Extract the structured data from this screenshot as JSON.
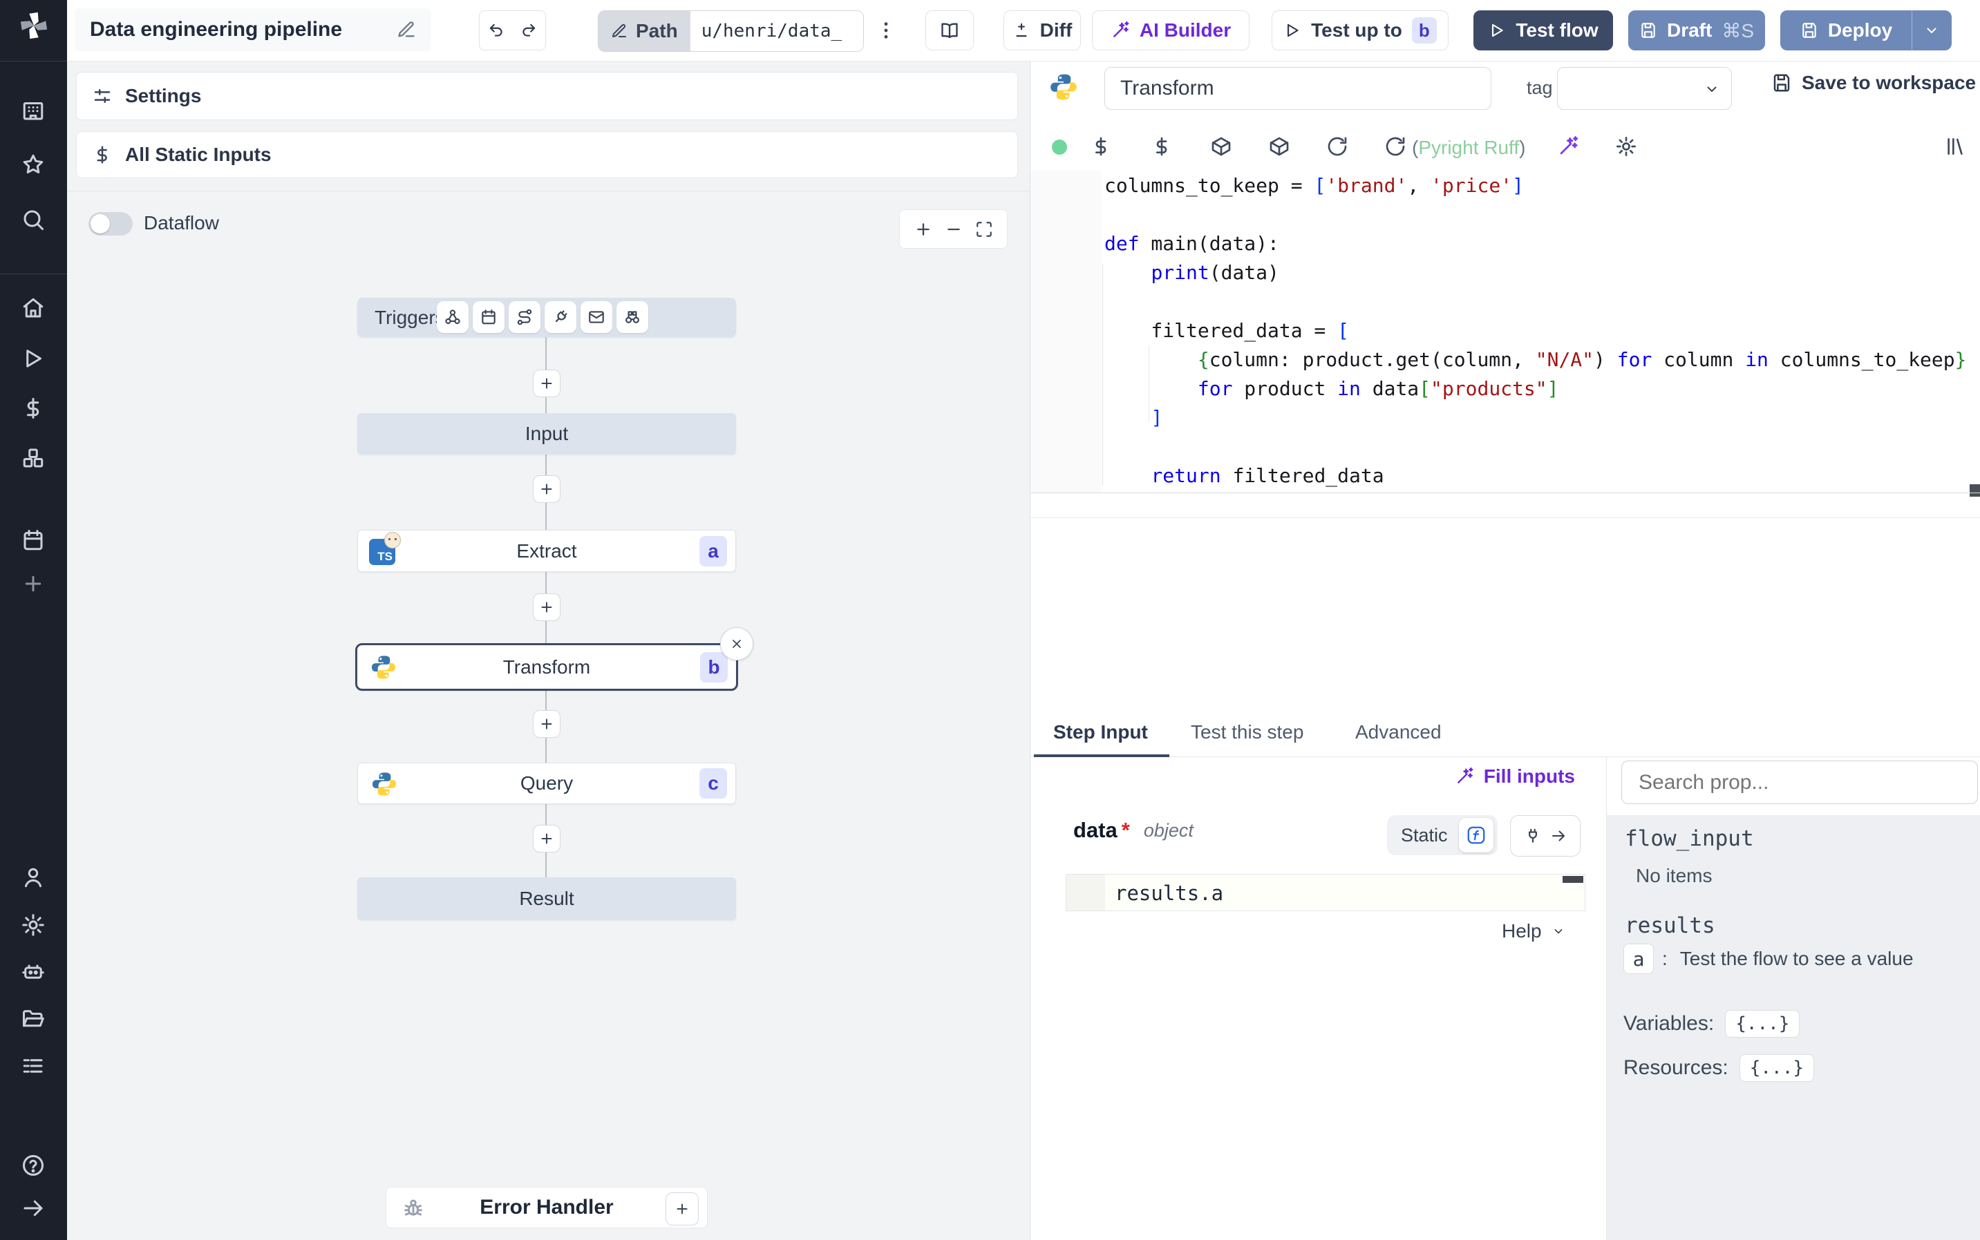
{
  "topbar": {
    "title": "Data engineering pipeline",
    "path_label": "Path",
    "path_value": "u/henri/data_",
    "diff_label": "Diff",
    "ai_builder_label": "AI Builder",
    "test_up_to_label": "Test up to",
    "test_up_to_badge": "b",
    "test_flow_label": "Test flow",
    "draft_label": "Draft",
    "draft_shortcut": "⌘S",
    "deploy_label": "Deploy"
  },
  "canvas": {
    "settings_label": "Settings",
    "static_inputs_label": "All Static Inputs",
    "dataflow_label": "Dataflow",
    "triggers_label": "Triggers",
    "nodes": {
      "input_label": "Input",
      "extract_label": "Extract",
      "extract_badge": "a",
      "extract_lang": "TS",
      "transform_label": "Transform",
      "transform_badge": "b",
      "query_label": "Query",
      "query_badge": "c",
      "result_label": "Result",
      "error_handler_label": "Error Handler"
    }
  },
  "editor": {
    "step_name": "Transform",
    "tag_label": "tag",
    "save_label": "Save to workspace",
    "lint_open": "(",
    "lint_name": "Pyright Ruff",
    "lint_close": ")",
    "code_lines": [
      [
        [
          "p",
          "columns_to_keep = "
        ],
        [
          "b",
          "["
        ],
        [
          "s",
          "'brand'"
        ],
        [
          "p",
          ", "
        ],
        [
          "s",
          "'price'"
        ],
        [
          "b",
          "]"
        ]
      ],
      [],
      [
        [
          "k",
          "def"
        ],
        [
          "p",
          " main(data):"
        ]
      ],
      [
        [
          "p",
          "    "
        ],
        [
          "k",
          "print"
        ],
        [
          "p",
          "(data)"
        ]
      ],
      [],
      [
        [
          "p",
          "    filtered_data = "
        ],
        [
          "b",
          "["
        ]
      ],
      [
        [
          "p",
          "        "
        ],
        [
          "g",
          "{"
        ],
        [
          "p",
          "column: product.get(column, "
        ],
        [
          "s",
          "\"N/A\""
        ],
        [
          "p",
          ") "
        ],
        [
          "k",
          "for"
        ],
        [
          "p",
          " column "
        ],
        [
          "k",
          "in"
        ],
        [
          "p",
          " columns_to_keep"
        ],
        [
          "g",
          "}"
        ]
      ],
      [
        [
          "p",
          "        "
        ],
        [
          "k",
          "for"
        ],
        [
          "p",
          " product "
        ],
        [
          "k",
          "in"
        ],
        [
          "p",
          " data"
        ],
        [
          "g",
          "["
        ],
        [
          "s",
          "\"products\""
        ],
        [
          "g",
          "]"
        ]
      ],
      [
        [
          "p",
          "    "
        ],
        [
          "b",
          "]"
        ]
      ],
      [],
      [
        [
          "p",
          "    "
        ],
        [
          "k",
          "return"
        ],
        [
          "p",
          " filtered_data"
        ]
      ]
    ]
  },
  "tabs": {
    "step_input": "Step Input",
    "test_this_step": "Test this step",
    "advanced": "Advanced"
  },
  "step_panel": {
    "fill_inputs_label": "Fill inputs",
    "field_name": "data",
    "required_mark": "*",
    "field_type": "object",
    "static_label": "Static",
    "expr_value": "results.a",
    "help_label": "Help"
  },
  "prop_panel": {
    "search_placeholder": "Search prop...",
    "flow_input_label": "flow_input",
    "flow_input_empty": "No items",
    "results_label": "results",
    "result_key": "a",
    "result_separator": ":",
    "result_hint": "Test the flow to see a value",
    "variables_label": "Variables:",
    "variables_value": "{...}",
    "resources_label": "Resources:",
    "resources_value": "{...}"
  },
  "colors": {
    "accent_purple": "#6d28d9",
    "test_flow_bg": "#3d4a66",
    "deploy_bg": "#6e89b8",
    "badge_bg": "#e0e4fc",
    "badge_text": "#4338ca",
    "lint_green": "#8ace9e",
    "status_green": "#6fd79b",
    "selected_node_border": "#3f4b63",
    "sidebar_bg": "#1c202a",
    "canvas_bg": "#f1f3f5",
    "python_blue": "#3776ab",
    "python_yellow": "#ffd43b",
    "ts_blue": "#3178c6"
  }
}
